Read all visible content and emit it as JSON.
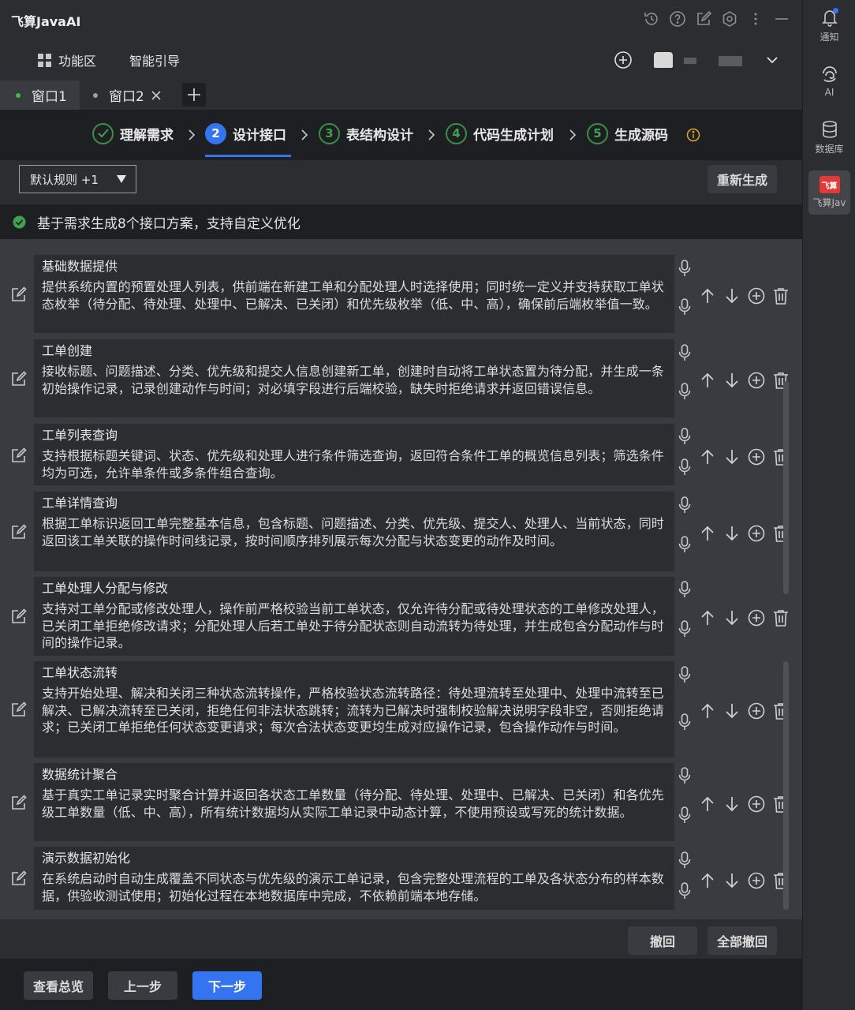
{
  "app": {
    "title": "飞算JavaAI",
    "top_icons": [
      "history-icon",
      "help-icon",
      "edit-icon",
      "settings-icon",
      "more-icon",
      "minimize-icon"
    ]
  },
  "menu": {
    "features": "功能区",
    "guide": "智能引导"
  },
  "tabs": [
    {
      "label": "窗口1",
      "active": true,
      "dot_color": "#3fb950"
    },
    {
      "label": "窗口2",
      "active": false,
      "dot_color": "#9a9da2"
    }
  ],
  "steps": [
    {
      "index": "✓",
      "label": "理解需求",
      "state": "done"
    },
    {
      "index": "2",
      "label": "设计接口",
      "state": "active"
    },
    {
      "index": "3",
      "label": "表结构设计",
      "state": "pending"
    },
    {
      "index": "4",
      "label": "代码生成计划",
      "state": "pending"
    },
    {
      "index": "5",
      "label": "生成源码",
      "state": "pending"
    }
  ],
  "toolbar": {
    "rule_select": "默认规则 +1",
    "regenerate": "重新生成"
  },
  "notice": "基于需求生成8个接口方案，支持自定义优化",
  "interfaces": [
    {
      "title": "基础数据提供",
      "desc": "提供系统内置的预置处理人列表，供前端在新建工单和分配处理人时选择使用；同时统一定义并支持获取工单状态枚举（待分配、待处理、处理中、已解决、已关闭）和优先级枚举（低、中、高），确保前后端枚举值一致。"
    },
    {
      "title": "工单创建",
      "desc": "接收标题、问题描述、分类、优先级和提交人信息创建新工单，创建时自动将工单状态置为待分配，并生成一条初始操作记录，记录创建动作与时间；对必填字段进行后端校验，缺失时拒绝请求并返回错误信息。"
    },
    {
      "title": "工单列表查询",
      "desc": "支持根据标题关键词、状态、优先级和处理人进行条件筛选查询，返回符合条件工单的概览信息列表；筛选条件均为可选，允许单条件或多条件组合查询。"
    },
    {
      "title": "工单详情查询",
      "desc": "根据工单标识返回工单完整基本信息，包含标题、问题描述、分类、优先级、提交人、处理人、当前状态，同时返回该工单关联的操作时间线记录，按时间顺序排列展示每次分配与状态变更的动作及时间。"
    },
    {
      "title": "工单处理人分配与修改",
      "desc": "支持对工单分配或修改处理人，操作前严格校验当前工单状态，仅允许待分配或待处理状态的工单修改处理人，已关闭工单拒绝修改请求；分配处理人后若工单处于待分配状态则自动流转为待处理，并生成包含分配动作与时间的操作记录。"
    },
    {
      "title": "工单状态流转",
      "desc": "支持开始处理、解决和关闭三种状态流转操作，严格校验状态流转路径：待处理流转至处理中、处理中流转至已解决、已解决流转至已关闭，拒绝任何非法状态跳转；流转为已解决时强制校验解决说明字段非空，否则拒绝请求；已关闭工单拒绝任何状态变更请求；每次合法状态变更均生成对应操作记录，包含操作动作与时间。"
    },
    {
      "title": "数据统计聚合",
      "desc": "基于真实工单记录实时聚合计算并返回各状态工单数量（待分配、待处理、处理中、已解决、已关闭）和各优先级工单数量（低、中、高），所有统计数据均从实际工单记录中动态计算，不使用预设或写死的统计数据。"
    },
    {
      "title": "演示数据初始化",
      "desc": "在系统启动时自动生成覆盖不同状态与优先级的演示工单记录，包含完整处理流程的工单及各状态分布的样本数据，供验收测试使用；初始化过程在本地数据库中完成，不依赖前端本地存储。"
    }
  ],
  "list_actions": {
    "undo": "撤回",
    "undo_all": "全部撤回"
  },
  "footer": {
    "overview": "查看总览",
    "prev": "上一步",
    "next": "下一步"
  },
  "rightbar": {
    "notify": "通知",
    "ai": "AI",
    "database": "数据库",
    "plugin": "飞算Jav",
    "plugin_logo": "飞算"
  },
  "colors": {
    "accent": "#3574f0",
    "success": "#3fa24f",
    "warning": "#e0a526",
    "brand_red": "#e53935"
  }
}
